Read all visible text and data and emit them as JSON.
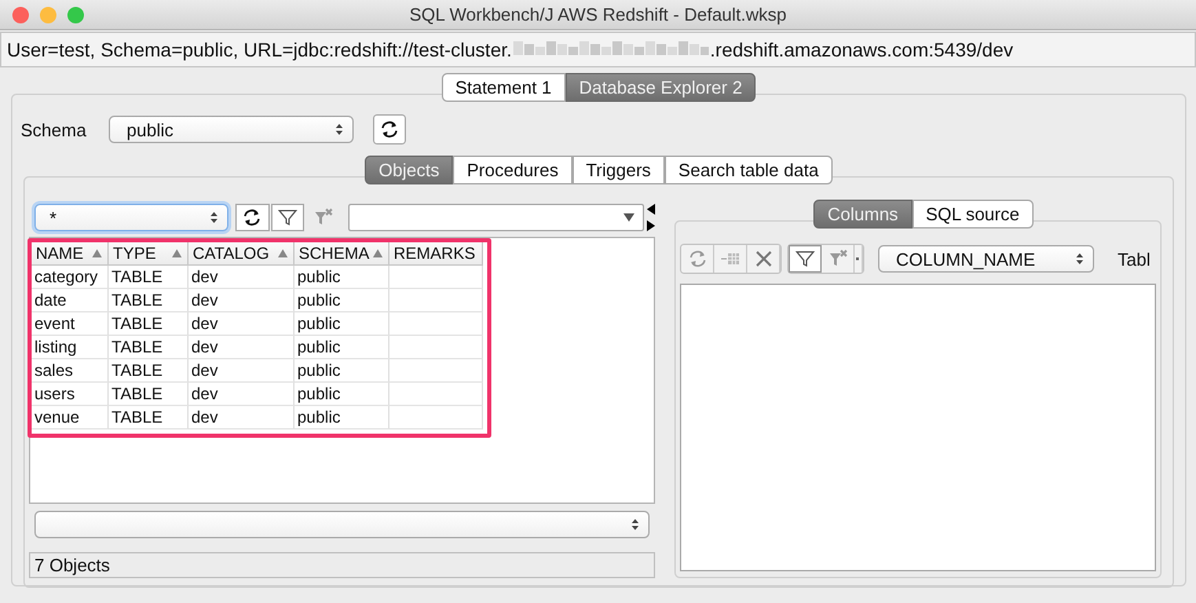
{
  "window": {
    "title": "SQL Workbench/J AWS Redshift - Default.wksp"
  },
  "connection_info": {
    "prefix": "User=test, Schema=public, URL=jdbc:redshift://test-cluster.",
    "suffix": ".redshift.amazonaws.com:5439/dev"
  },
  "main_tabs": [
    {
      "label": "Statement 1",
      "selected": false
    },
    {
      "label": "Database Explorer 2",
      "selected": true
    }
  ],
  "schema": {
    "label": "Schema",
    "value": "public"
  },
  "object_tabs": [
    {
      "label": "Objects",
      "selected": true
    },
    {
      "label": "Procedures",
      "selected": false
    },
    {
      "label": "Triggers",
      "selected": false
    },
    {
      "label": "Search table data",
      "selected": false
    }
  ],
  "object_filter": {
    "value": "*"
  },
  "table": {
    "columns": [
      {
        "label": "NAME",
        "sorted": true
      },
      {
        "label": "TYPE",
        "sorted": true
      },
      {
        "label": "CATALOG",
        "sorted": true
      },
      {
        "label": "SCHEMA",
        "sorted": true
      },
      {
        "label": "REMARKS",
        "sorted": false
      }
    ],
    "rows": [
      [
        "category",
        "TABLE",
        "dev",
        "public"
      ],
      [
        "date",
        "TABLE",
        "dev",
        "public"
      ],
      [
        "event",
        "TABLE",
        "dev",
        "public"
      ],
      [
        "listing",
        "TABLE",
        "dev",
        "public"
      ],
      [
        "sales",
        "TABLE",
        "dev",
        "public"
      ],
      [
        "users",
        "TABLE",
        "dev",
        "public"
      ],
      [
        "venue",
        "TABLE",
        "dev",
        "public"
      ]
    ]
  },
  "status": "7 Objects",
  "detail_tabs": [
    {
      "label": "Columns",
      "selected": true
    },
    {
      "label": "SQL source",
      "selected": false
    }
  ],
  "column_sort": {
    "value": "COLUMN_NAME"
  },
  "column_3": "Tabl"
}
